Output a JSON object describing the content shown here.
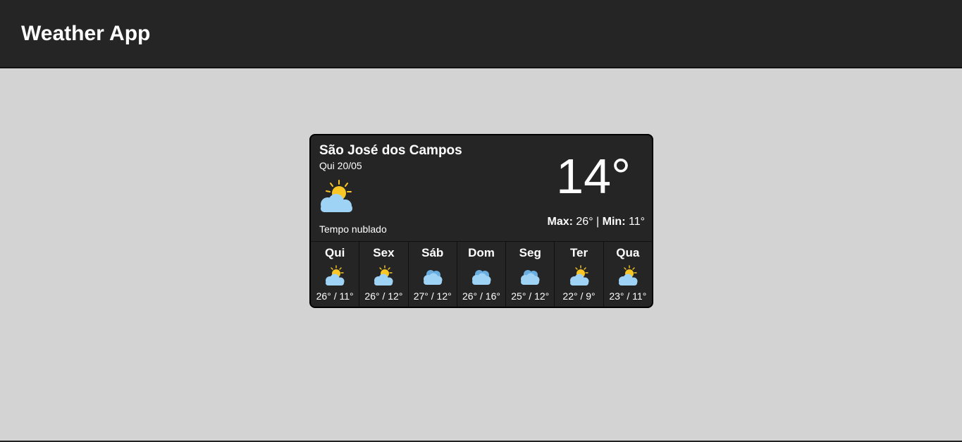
{
  "app": {
    "title": "Weather App"
  },
  "current": {
    "city": "São José dos Campos",
    "date": "Qui 20/05",
    "icon": "partly-cloudy-icon",
    "condition": "Tempo nublado",
    "temperature": "14°",
    "max_label": "Max:",
    "max_value": "26°",
    "separator": "|",
    "min_label": "Min:",
    "min_value": "11°"
  },
  "forecast": [
    {
      "day": "Qui",
      "icon": "partly-cloudy-icon",
      "range": "26° / 11°"
    },
    {
      "day": "Sex",
      "icon": "partly-cloudy-icon",
      "range": "26° / 12°"
    },
    {
      "day": "Sáb",
      "icon": "cloudy-icon",
      "range": "27° / 12°"
    },
    {
      "day": "Dom",
      "icon": "cloudy-icon",
      "range": "26° / 16°"
    },
    {
      "day": "Seg",
      "icon": "cloudy-icon",
      "range": "25° / 12°"
    },
    {
      "day": "Ter",
      "icon": "partly-cloudy-icon",
      "range": "22° / 9°"
    },
    {
      "day": "Qua",
      "icon": "partly-cloudy-icon",
      "range": "23° / 11°"
    }
  ],
  "colors": {
    "header_bg": "#252525",
    "page_bg": "#d3d3d3",
    "card_bg": "#252525",
    "sun": "#f9c623",
    "cloud": "#9fd3f5",
    "cloud_dark": "#6aaee0"
  }
}
